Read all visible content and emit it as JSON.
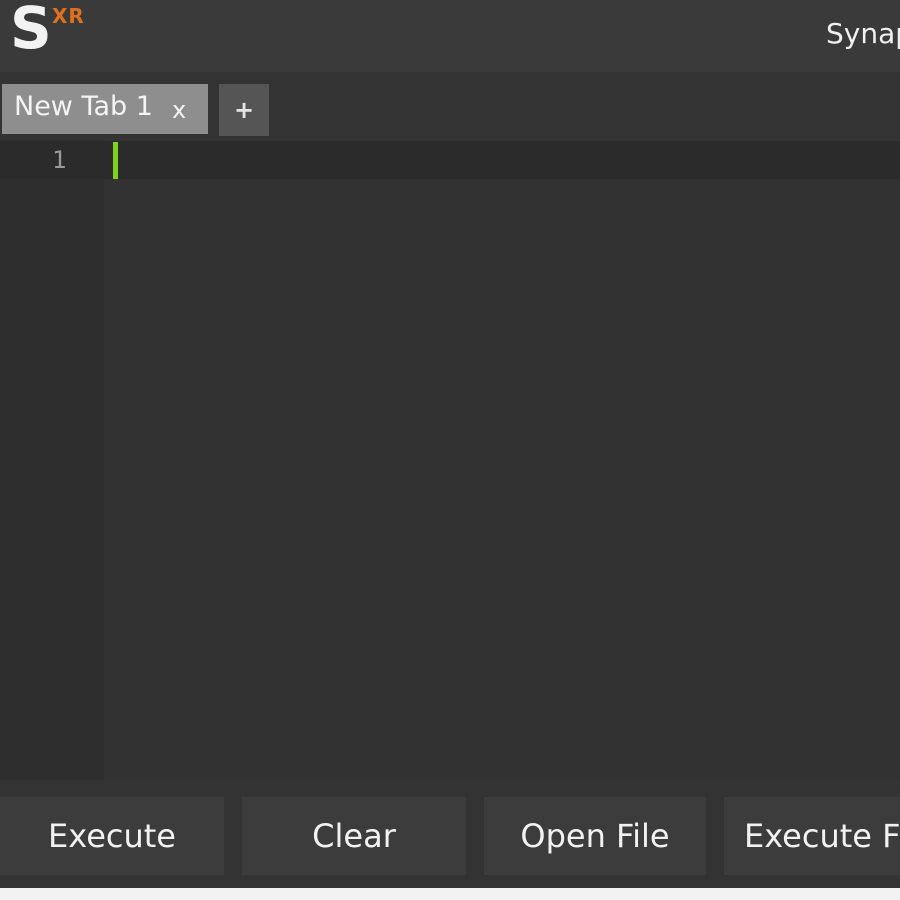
{
  "logo": {
    "main": "S",
    "superscript": "XR"
  },
  "window": {
    "title": "Synapse X"
  },
  "tabs": [
    {
      "label": "New Tab 1",
      "close": "x"
    }
  ],
  "new_tab": {
    "label": "+"
  },
  "editor": {
    "lines": [
      {
        "number": "1",
        "text": ""
      }
    ],
    "caret_color": "#7ed321"
  },
  "buttons": {
    "execute": "Execute",
    "clear": "Clear",
    "open_file": "Open File",
    "execute_file": "Execute File"
  },
  "colors": {
    "background": "#333333",
    "accent": "#e0701e",
    "tab_active": "#8e8e8e"
  }
}
